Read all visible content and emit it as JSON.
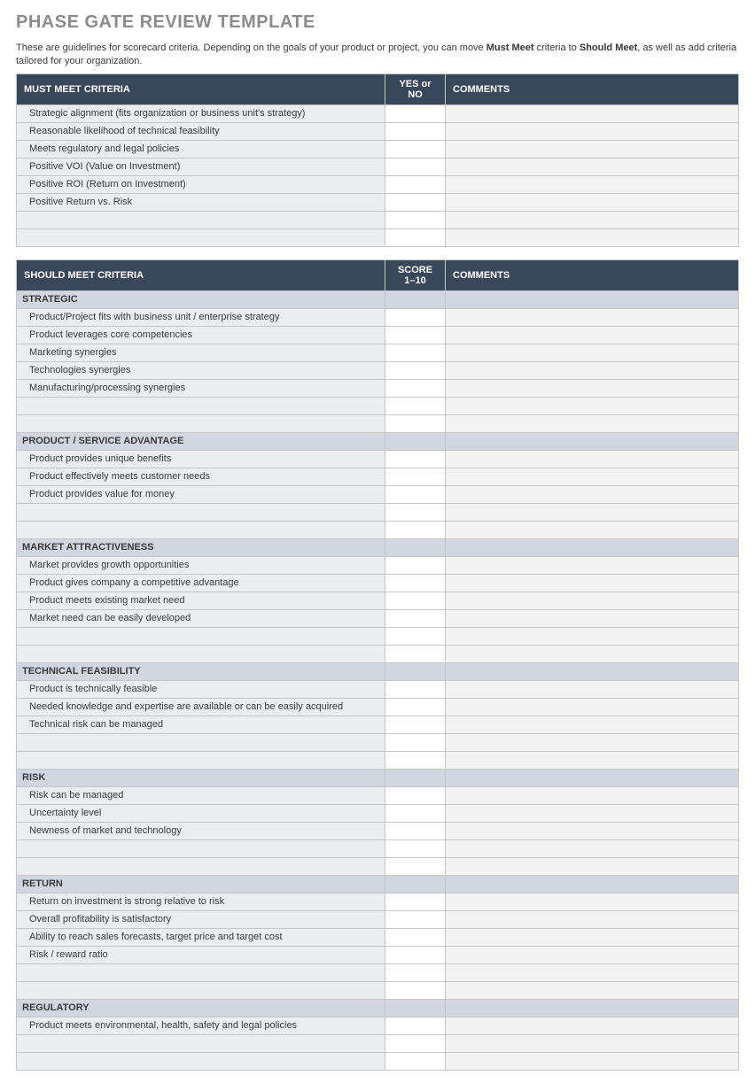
{
  "title": "PHASE GATE REVIEW TEMPLATE",
  "intro_pre": "These are guidelines for scorecard criteria. Depending on the goals of your product or project, you can move ",
  "intro_b1": "Must Meet",
  "intro_mid": " criteria to ",
  "intro_b2": "Should Meet",
  "intro_post": ", as well as add criteria tailored for your organization.",
  "must": {
    "h1": "MUST MEET CRITERIA",
    "h2": "YES or NO",
    "h3": "COMMENTS",
    "rows": [
      "Strategic alignment (fits organization or business unit's strategy)",
      "Reasonable likelihood of technical feasibility",
      "Meets regulatory and legal policies",
      "Positive VOI (Value on Investment)",
      "Positive ROI (Return on Investment)",
      "Positive Return vs. Risk",
      "",
      ""
    ]
  },
  "should": {
    "h1": "SHOULD MEET CRITERIA",
    "h2": "SCORE 1–10",
    "h3": "COMMENTS",
    "groups": [
      {
        "title": "STRATEGIC",
        "rows": [
          "Product/Project fits with business unit / enterprise strategy",
          "Product leverages core competencies",
          "Marketing synergies",
          "Technologies synergies",
          "Manufacturing/processing synergies",
          "",
          ""
        ]
      },
      {
        "title": "PRODUCT / SERVICE ADVANTAGE",
        "rows": [
          "Product provides unique benefits",
          "Product effectively meets customer needs",
          "Product provides value for money",
          "",
          ""
        ]
      },
      {
        "title": "MARKET ATTRACTIVENESS",
        "rows": [
          "Market provides growth opportunities",
          "Product gives company a competitive advantage",
          "Product meets existing market need",
          "Market need can be easily developed",
          "",
          ""
        ]
      },
      {
        "title": "TECHNICAL FEASIBILITY",
        "rows": [
          "Product is technically feasible",
          "Needed knowledge and expertise are available or can be easily acquired",
          "Technical risk can be managed",
          "",
          ""
        ]
      },
      {
        "title": "RISK",
        "rows": [
          "Risk can be managed",
          "Uncertainty level",
          "Newness of market and technology",
          "",
          ""
        ]
      },
      {
        "title": "RETURN",
        "rows": [
          "Return on investment is strong relative to risk",
          "Overall profitability is satisfactory",
          "Ability to reach sales forecasts, target price and target cost",
          "Risk / reward ratio",
          "",
          ""
        ]
      },
      {
        "title": "REGULATORY",
        "rows": [
          "Product meets environmental, health, safety and legal policies",
          "",
          ""
        ]
      }
    ]
  }
}
